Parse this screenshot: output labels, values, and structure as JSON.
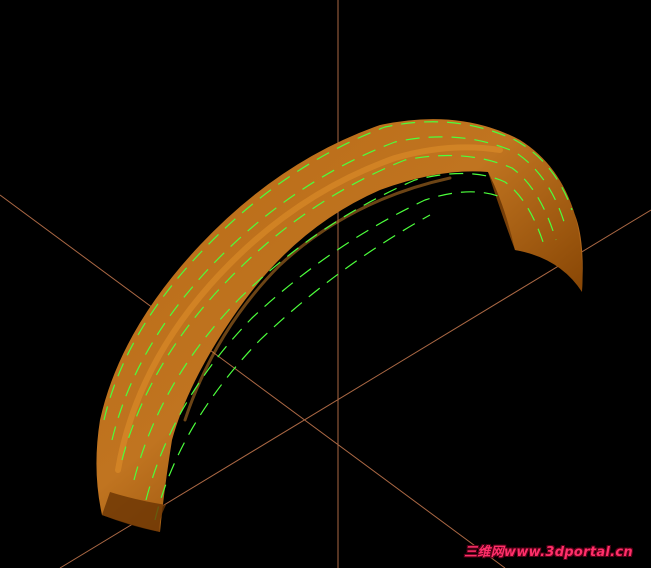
{
  "viewport": {
    "background": "#000000",
    "axis_color": "#c87a50",
    "model_color": "#a0560a",
    "model_highlight": "#e0902a",
    "model_shadow": "#5a2c02",
    "isoline_color": "#4cff3c"
  },
  "watermark": {
    "text": "三维网www.3dportal.cn",
    "color": "#ff2f6a"
  }
}
